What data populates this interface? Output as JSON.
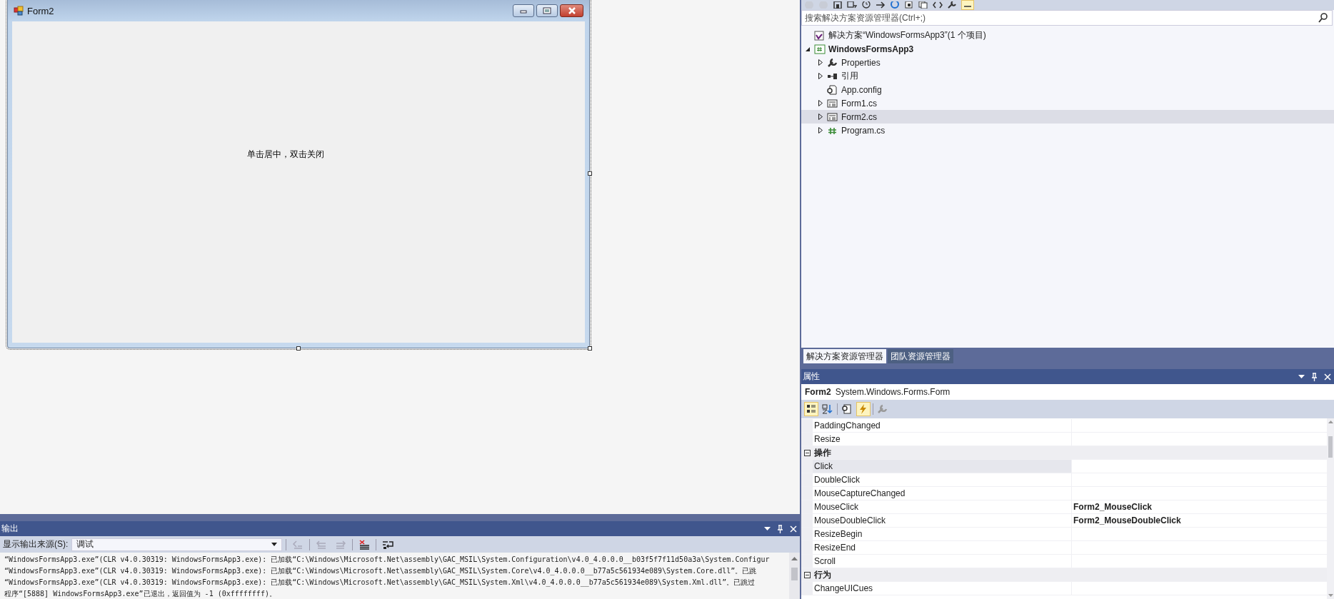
{
  "designer": {
    "form": {
      "title": "Form2",
      "label": "单击居中，双击关闭"
    }
  },
  "output": {
    "title": "输出",
    "source_label": "显示输出来源(S):",
    "source_value": "调试",
    "lines": [
      "“WindowsFormsApp3.exe”(CLR v4.0.30319: WindowsFormsApp3.exe): 已加载“C:\\Windows\\Microsoft.Net\\assembly\\GAC_MSIL\\System.Configuration\\v4.0_4.0.0.0__b03f5f7f11d50a3a\\System.Configur",
      "“WindowsFormsApp3.exe”(CLR v4.0.30319: WindowsFormsApp3.exe): 已加载“C:\\Windows\\Microsoft.Net\\assembly\\GAC_MSIL\\System.Core\\v4.0_4.0.0.0__b77a5c561934e089\\System.Core.dll”。已跳",
      "“WindowsFormsApp3.exe”(CLR v4.0.30319: WindowsFormsApp3.exe): 已加载“C:\\Windows\\Microsoft.Net\\assembly\\GAC_MSIL\\System.Xml\\v4.0_4.0.0.0__b77a5c561934e089\\System.Xml.dll”。已跳过",
      "程序“[5888] WindowsFormsApp3.exe”已退出，返回值为 -1 (0xffffffff)。"
    ]
  },
  "solution_explorer": {
    "search": {
      "placeholder": "搜索解决方案资源管理器(Ctrl+;)"
    },
    "tree": [
      {
        "kind": "solution",
        "label": "解决方案“WindowsFormsApp3”(1 个项目)",
        "selected": false,
        "children": [
          {
            "kind": "project",
            "label": "WindowsFormsApp3",
            "expanded": true,
            "selected": false,
            "children": [
              {
                "kind": "properties",
                "label": "Properties",
                "expanded": false,
                "selected": false
              },
              {
                "kind": "references",
                "label": "引用",
                "expanded": false,
                "selected": false
              },
              {
                "kind": "config",
                "label": "App.config",
                "selected": false
              },
              {
                "kind": "form",
                "label": "Form1.cs",
                "expanded": false,
                "selected": false
              },
              {
                "kind": "form",
                "label": "Form2.cs",
                "expanded": false,
                "selected": true
              },
              {
                "kind": "csharp",
                "label": "Program.cs",
                "expanded": false,
                "selected": false
              }
            ]
          }
        ]
      }
    ],
    "tabs": [
      {
        "label": "解决方案资源管理器",
        "selected": true
      },
      {
        "label": "团队资源管理器",
        "selected": false
      }
    ]
  },
  "properties": {
    "title": "属性",
    "object_name": "Form2",
    "object_type": "System.Windows.Forms.Form",
    "toolbar": [
      {
        "kind": "categorized",
        "selected": true
      },
      {
        "kind": "alphabetical",
        "selected": false
      },
      {
        "kind": "property-pages",
        "selected": false
      },
      {
        "kind": "events",
        "selected": true
      },
      {
        "kind": "settings",
        "selected": false
      }
    ],
    "rows": [
      {
        "kind": "event",
        "name": "PaddingChanged",
        "selected": false
      },
      {
        "kind": "event",
        "name": "Resize",
        "selected": false
      },
      {
        "kind": "category",
        "name": "操作",
        "expanded": true
      },
      {
        "kind": "event",
        "name": "Click",
        "selected": true
      },
      {
        "kind": "event",
        "name": "DoubleClick",
        "selected": false
      },
      {
        "kind": "event",
        "name": "MouseCaptureChanged",
        "selected": false
      },
      {
        "kind": "event",
        "name": "MouseClick",
        "value": "Form2_MouseClick",
        "selected": false
      },
      {
        "kind": "event",
        "name": "MouseDoubleClick",
        "value": "Form2_MouseDoubleClick",
        "selected": false
      },
      {
        "kind": "event",
        "name": "ResizeBegin",
        "selected": false
      },
      {
        "kind": "event",
        "name": "ResizeEnd",
        "selected": false
      },
      {
        "kind": "event",
        "name": "Scroll",
        "selected": false
      },
      {
        "kind": "category",
        "name": "行为",
        "expanded": true
      },
      {
        "kind": "event",
        "name": "ChangeUICues",
        "selected": false
      }
    ]
  }
}
